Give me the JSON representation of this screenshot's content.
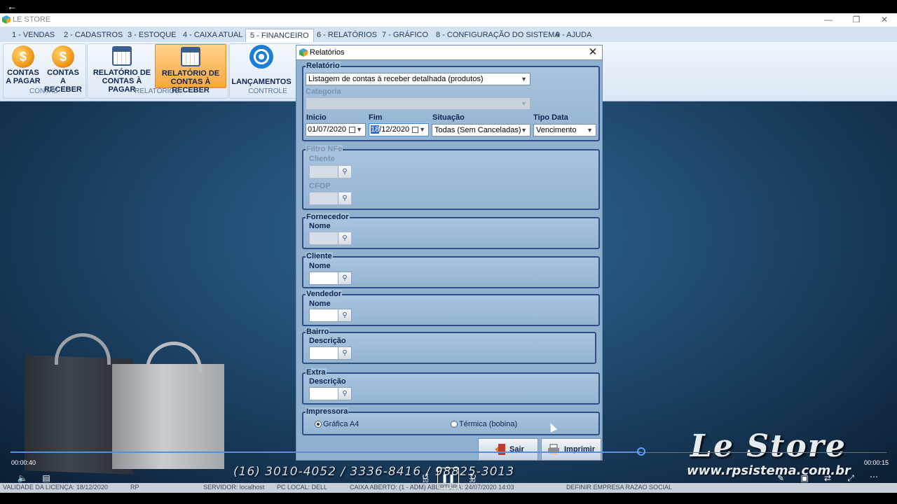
{
  "app": {
    "title": "LE STORE",
    "menu": [
      "1 - VENDAS",
      "2 - CADASTROS",
      "3 - ESTOQUE",
      "4 - CAIXA ATUAL",
      "5 - FINANCEIRO",
      "6 - RELATÓRIOS",
      "7 - GRÁFICO",
      "8 - CONFIGURAÇÃO DO SISTEMA",
      "9 - AJUDA"
    ],
    "ribbon": {
      "contas_pagar": [
        "CONTAS",
        "A PAGAR"
      ],
      "contas_receber": [
        "CONTAS A",
        "RECEBER"
      ],
      "group_contas": "CONTAS",
      "rel_pagar": [
        "RELATÓRIO DE",
        "CONTAS À PAGAR"
      ],
      "rel_receber": [
        "RELATÓRIO DE",
        "CONTAS À RECEBER"
      ],
      "group_relatorios": "RELATÓRIOS",
      "lancamentos": "LANÇAMENTOS",
      "group_controle": "CONTROLE"
    },
    "status": {
      "licenca": "VALIDADE DA LICENÇA: 18/12/2020",
      "rp": "RP",
      "servidor": "SERVIDOR: localhost",
      "pc": "PC LOCAL: DELL",
      "caixa": "CAIXA ABERTO: (1 - ADM) ABERTURA: 24/07/2020 14:03",
      "empresa": "DEFINIR EMPRESA RAZAO SOCIAL"
    }
  },
  "dialog": {
    "title": "Relatórios",
    "relatorio": {
      "legend": "Relatório",
      "value": "Listagem de contas à receber detalhada (produtos)"
    },
    "categoria": {
      "label": "Categoria",
      "value": ""
    },
    "inicio": {
      "label": "Inicio",
      "value": "01/07/2020"
    },
    "fim": {
      "label": "Fim",
      "day": "18",
      "rest": "/12/2020"
    },
    "situacao": {
      "label": "Situação",
      "value": "Todas (Sem Canceladas)"
    },
    "tipo_data": {
      "label": "Tipo Data",
      "value": "Vencimento"
    },
    "filtro_nfe": {
      "legend": "Filtro NFe",
      "cliente": "Cliente",
      "cfop": "CFOP"
    },
    "fornecedor": {
      "legend": "Fornecedor",
      "field": "Nome"
    },
    "cliente": {
      "legend": "Cliente",
      "field": "Nome"
    },
    "vendedor": {
      "legend": "Vendedor",
      "field": "Nome"
    },
    "bairro": {
      "legend": "Bairro",
      "field": "Descrição"
    },
    "extra": {
      "legend": "Extra",
      "field": "Descrição"
    },
    "impressora": {
      "legend": "Impressora",
      "option_a4": "Gráfica A4",
      "option_termica": "Térmica (bobina)",
      "selected": "Gráfica A4"
    },
    "btn_sair": "Sair",
    "btn_imprimir": "Imprimir"
  },
  "player": {
    "elapsed": "00:00:40",
    "remaining": "00:00:15",
    "progress_fraction": 0.72,
    "skip_back": "10",
    "skip_fwd": "30"
  },
  "overlay": {
    "brand": "Le Store",
    "url": "www.rpsistema.com.br",
    "phones": "(16) 3010-4052 / 3336-8416 / 98825-3013"
  }
}
